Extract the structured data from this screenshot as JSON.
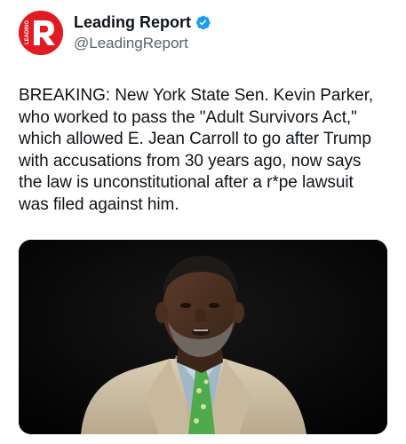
{
  "author": {
    "display_name": "Leading Report",
    "handle": "@LeadingReport",
    "verified": true,
    "avatar_letter": "R",
    "avatar_side_text": "LEADING",
    "avatar_color": "#e11b22"
  },
  "tweet": {
    "lines": [
      "BREAKING: New York State Sen. Kevin Parker,",
      "who worked to pass the \"Adult Survivors Act,\"",
      "which allowed E. Jean Carroll to go after Trump",
      "with accusations from 30 years ago, now says",
      "the law is unconstitutional after a r*pe lawsuit",
      "was filed against him."
    ]
  },
  "media": {
    "icon": "photo-of-man-speaking"
  },
  "colors": {
    "verified_badge": "#1d9bf0",
    "handle_gray": "#536471",
    "text": "#0f1419"
  }
}
